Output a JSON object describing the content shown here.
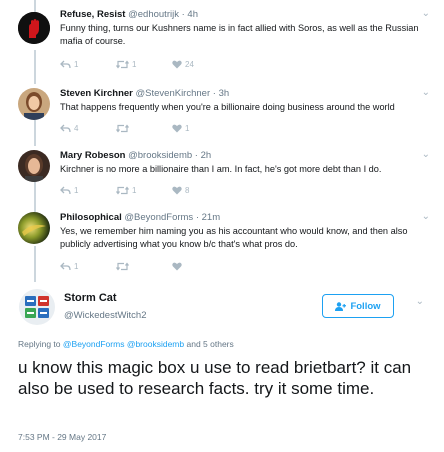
{
  "thread": [
    {
      "name": "Refuse, Resist",
      "handle": "@edhoutrijk",
      "time": "4h",
      "text": "Funny thing, turns our Kushners name is in fact allied with Soros, as well as the Russian mafia of course.",
      "reply_count": "1",
      "retweet_count": "1",
      "like_count": "24"
    },
    {
      "name": "Steven Kirchner",
      "handle": "@StevenKirchner",
      "time": "3h",
      "text": "That happens frequently when you're a billionaire doing business around the world",
      "reply_count": "4",
      "retweet_count": "",
      "like_count": "1"
    },
    {
      "name": "Mary Robeson",
      "handle": "@brooksidemb",
      "time": "2h",
      "text": "Kirchner is no more a billionaire than I am. In fact, he's got more debt than I do.",
      "reply_count": "1",
      "retweet_count": "1",
      "like_count": "8"
    },
    {
      "name": "Philosophical",
      "handle": "@BeyondForms",
      "time": "21m",
      "text": "Yes, we remember him naming you as his accountant who would know, and then also publicly advertising what you know b/c that's what pros do.",
      "reply_count": "1",
      "retweet_count": "",
      "like_count": ""
    }
  ],
  "main_tweet": {
    "name": "Storm Cat",
    "handle": "@WickedestWitch2",
    "follow_label": "Follow",
    "replying_prefix": "Replying to",
    "replying_mention_1": "@BeyondForms",
    "replying_mention_2": "@brooksidemb",
    "replying_suffix": "and 5 others",
    "text": "u know this magic box u use to read brietbart? it can also be used to research facts. try it some time.",
    "timestamp": "7:53 PM - 29 May 2017"
  },
  "colors": {
    "accent": "#1da1f2",
    "secondary_text": "#657786",
    "icon_gray": "#aab8c2",
    "thread_line": "#ccd6dd"
  },
  "icons": [
    "reply-icon",
    "retweet-icon",
    "heart-icon",
    "chevron-down-icon",
    "add-person-icon"
  ]
}
